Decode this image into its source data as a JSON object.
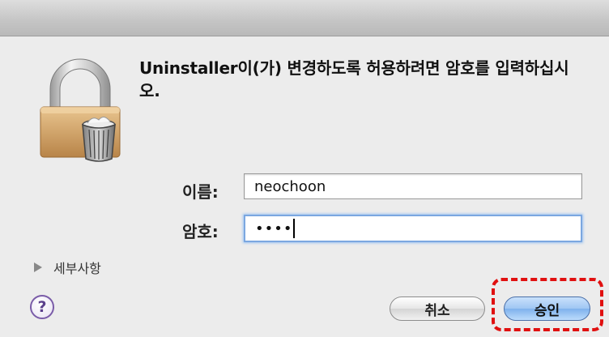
{
  "dialog": {
    "message": "Uninstaller이(가) 변경하도록 허용하려면 암호를 입력하십시오.",
    "icon": "lock-trash-icon"
  },
  "fields": {
    "name_label": "이름:",
    "name_value": "neochoon",
    "password_label": "암호:",
    "password_value": "••••"
  },
  "details": {
    "label": "세부사항",
    "icon": "disclosure-triangle-icon"
  },
  "help": {
    "label": "?"
  },
  "buttons": {
    "cancel_label": "취소",
    "approve_label": "승인"
  },
  "colors": {
    "highlight": "#e01010",
    "default_button": "#9fc6f3",
    "focus_ring": "#7ba7e0"
  }
}
